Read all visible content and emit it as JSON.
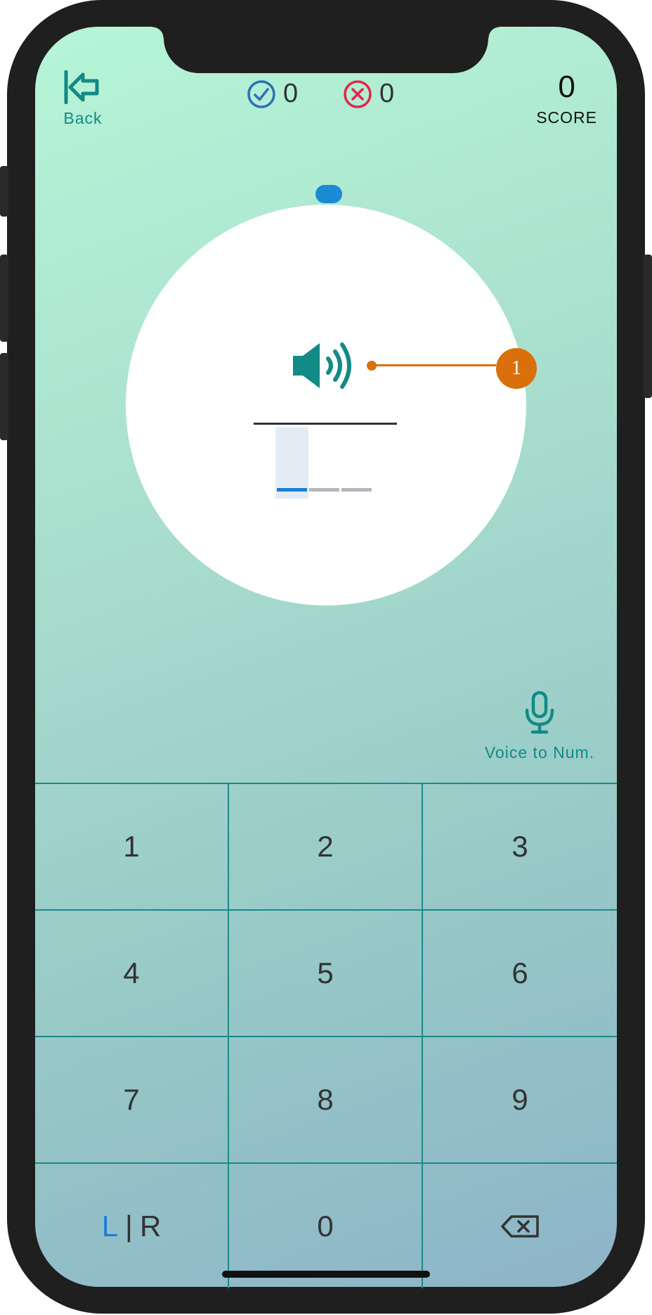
{
  "header": {
    "back_label": "Back",
    "correct_count": "0",
    "wrong_count": "0",
    "score_value": "0",
    "score_label": "SCORE"
  },
  "display": {
    "entered_digits": "",
    "digit_slots": 3,
    "active_slot": 1
  },
  "callout": {
    "label": "1"
  },
  "voice": {
    "label": "Voice to Num."
  },
  "keypad": {
    "keys": [
      "1",
      "2",
      "3",
      "4",
      "5",
      "6",
      "7",
      "8",
      "9"
    ],
    "zero": "0",
    "lr_left": "L",
    "lr_sep": "|",
    "lr_right": "R"
  },
  "colors": {
    "accent_teal": "#128a85",
    "accent_blue": "#1b8bd6",
    "callout_orange": "#d9700c",
    "correct_blue": "#2f6fb5",
    "wrong_red": "#e0284a"
  },
  "icons": {
    "back": "back-arrow-icon",
    "correct": "check-circle-icon",
    "wrong": "x-circle-icon",
    "speaker": "speaker-icon",
    "microphone": "microphone-icon",
    "backspace": "backspace-icon"
  }
}
